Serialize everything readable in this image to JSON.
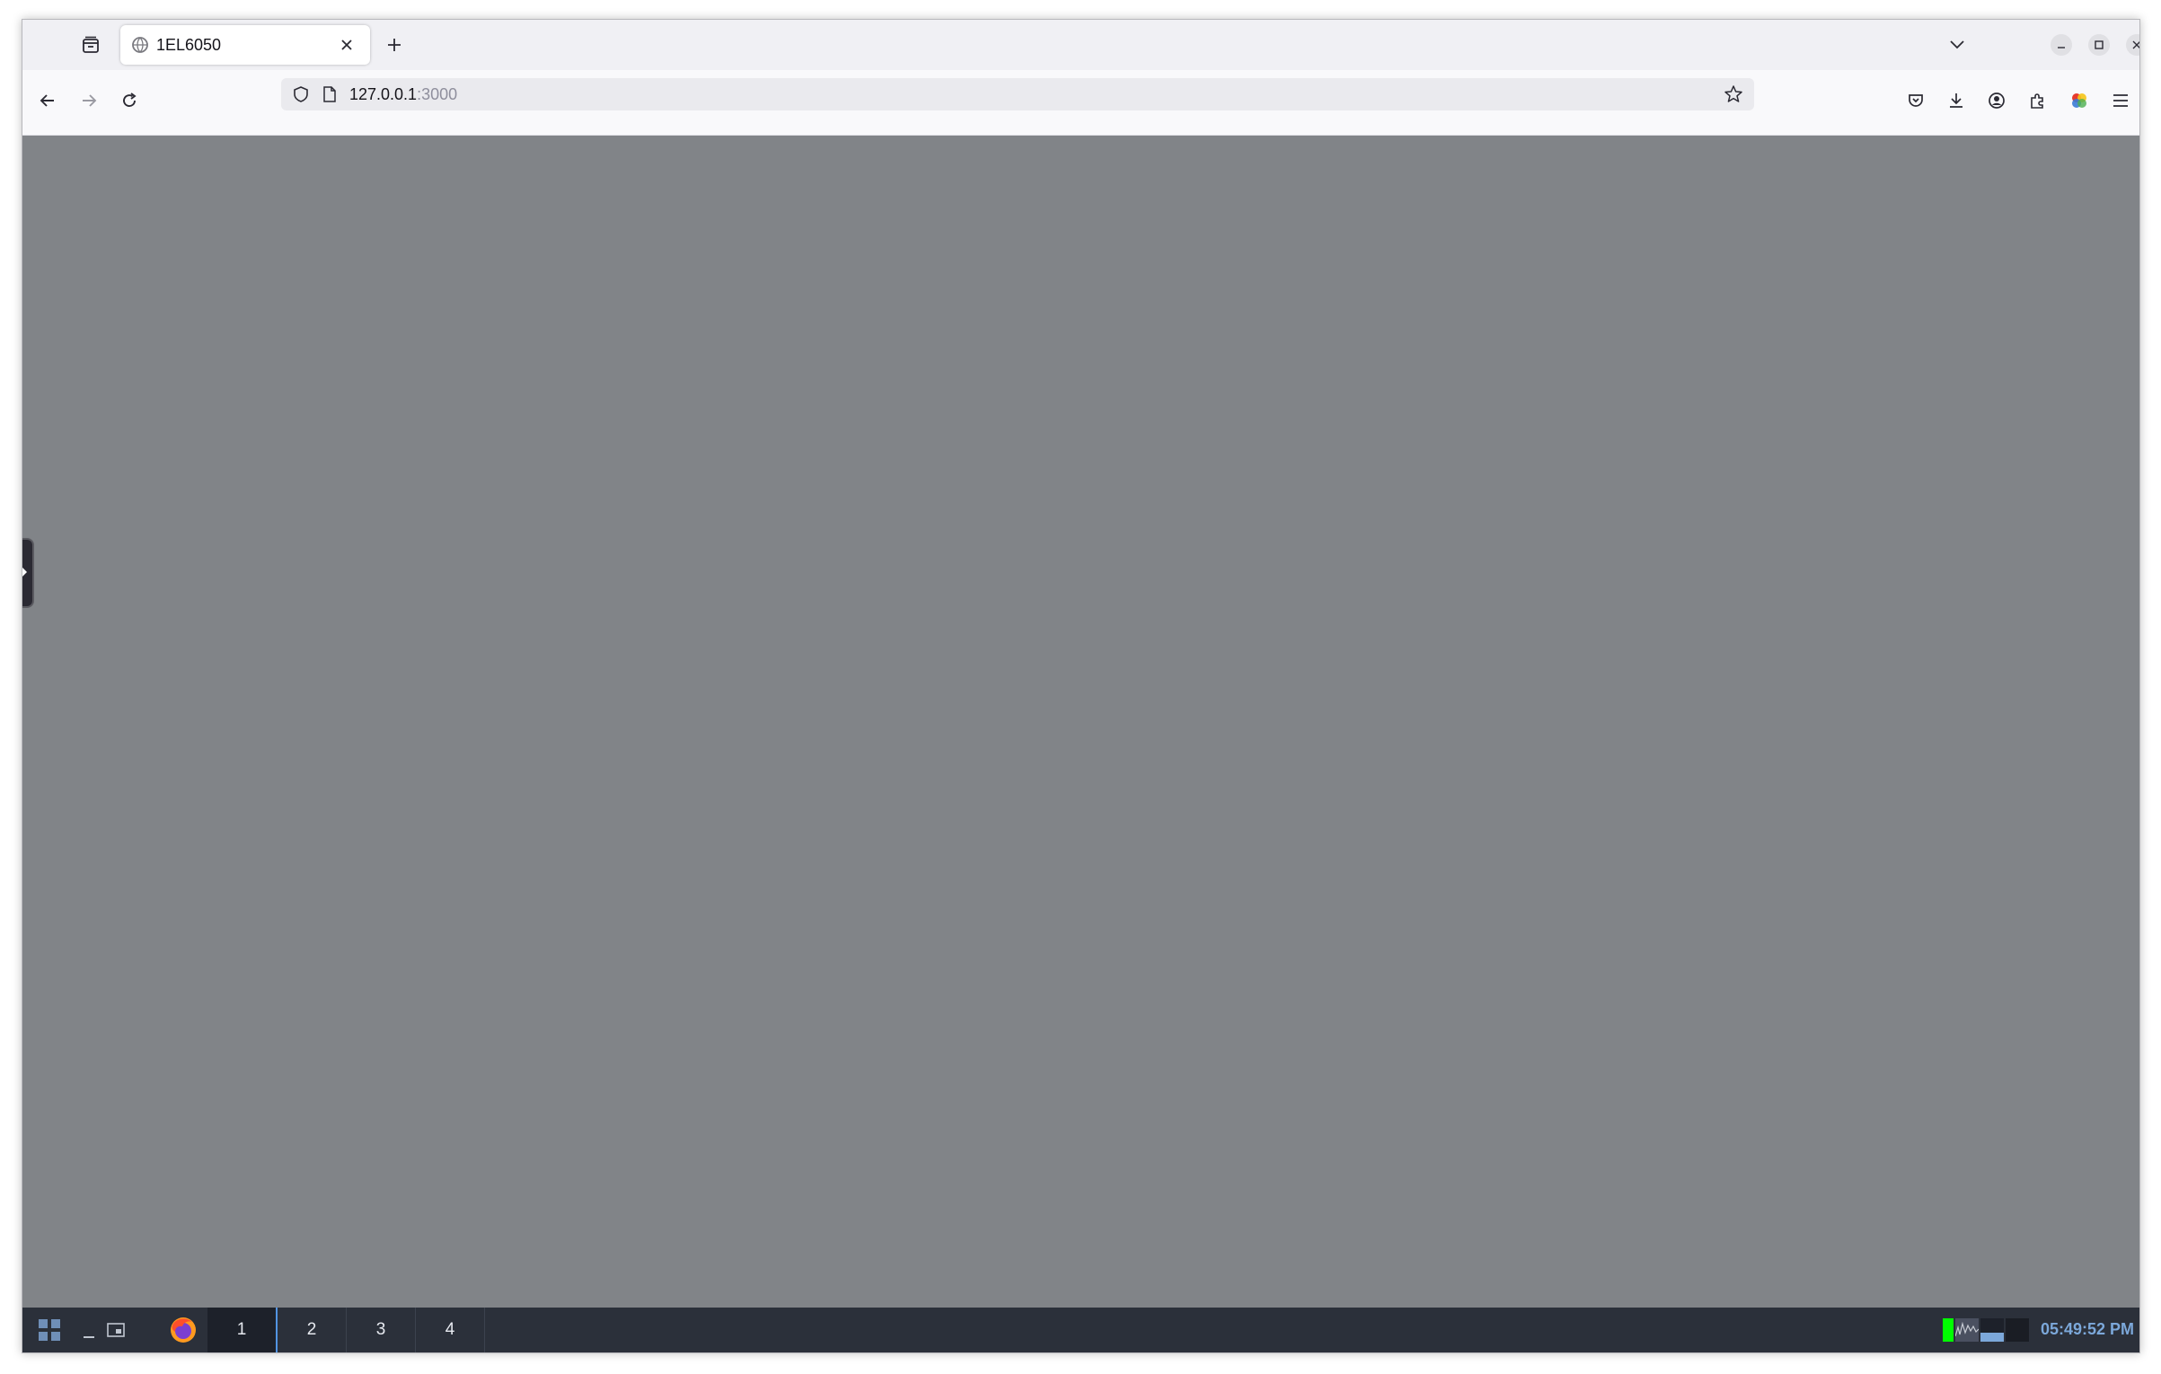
{
  "browser": {
    "tab": {
      "title": "1EL6050"
    },
    "url": {
      "host": "127.0.0.1",
      "port": ":3000"
    }
  },
  "taskbar": {
    "workspaces": [
      {
        "label": "1",
        "active": true
      },
      {
        "label": "2",
        "active": false
      },
      {
        "label": "3",
        "active": false
      },
      {
        "label": "4",
        "active": false
      }
    ],
    "clock": "05:49:52 PM"
  },
  "colors": {
    "content_background": "#818488",
    "taskbar_background": "#2b303a",
    "active_workspace_accent": "#5294e2",
    "cpu_meter": "#00ff00",
    "clock_text": "#7ca8da"
  },
  "icons": [
    "tab-overview-icon",
    "site-favicon",
    "close-tab-icon",
    "new-tab-icon",
    "list-all-tabs-icon",
    "minimize-icon",
    "maximize-icon",
    "window-close-icon",
    "back-icon",
    "forward-icon",
    "reload-icon",
    "shield-icon",
    "page-icon",
    "star-icon",
    "pocket-icon",
    "download-icon",
    "account-icon",
    "extensions-icon",
    "color-extension-icon",
    "menu-icon",
    "app-grid-icon",
    "show-desktop-icon",
    "firefox-icon"
  ]
}
